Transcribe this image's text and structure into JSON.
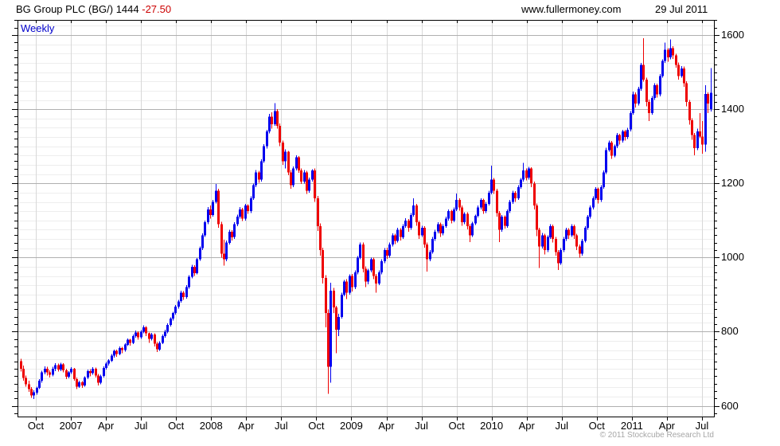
{
  "header": {
    "title": "BG Group PLC (BG/) 1444",
    "change": "-27.50",
    "website": "www.fullermoney.com",
    "date": "29 Jul 2011"
  },
  "chart": {
    "timeframe_label": "Weekly"
  },
  "footer": {
    "copyright": "© 2011 Stockcube Research Ltd"
  },
  "colors": {
    "up": "#0000ee",
    "down": "#ee0000",
    "grid_minor": "#ededed",
    "grid_vertical": "#d8d8d8",
    "grid_major": "#b0b0b0",
    "frame": "#000000"
  },
  "chart_data": {
    "type": "candlestick",
    "title": "BG Group PLC (BG/)",
    "timeframe": "Weekly",
    "last_price": 1444,
    "change": -27.5,
    "x_tick_labels": [
      "Oct",
      "2007",
      "Apr",
      "Jul",
      "Oct",
      "2008",
      "Apr",
      "Jul",
      "Oct",
      "2009",
      "Apr",
      "Jul",
      "Oct",
      "2010",
      "Apr",
      "Jul",
      "Oct",
      "2011",
      "Apr",
      "Jul"
    ],
    "y_tick_values": [
      600,
      800,
      1000,
      1200,
      1400,
      1600
    ],
    "ylim": [
      571,
      1641
    ],
    "y_major_step": 200,
    "y_minor_grid_step": 25,
    "y_minor_tick_step": 20,
    "grid": true,
    "legend": "none",
    "candles_ohlc": [
      [
        720,
        727,
        692,
        700
      ],
      [
        700,
        708,
        668,
        675
      ],
      [
        675,
        682,
        652,
        658
      ],
      [
        658,
        668,
        638,
        645
      ],
      [
        645,
        650,
        622,
        628
      ],
      [
        628,
        642,
        618,
        636
      ],
      [
        636,
        652,
        630,
        648
      ],
      [
        648,
        672,
        645,
        668
      ],
      [
        668,
        695,
        662,
        690
      ],
      [
        690,
        706,
        685,
        700
      ],
      [
        700,
        705,
        682,
        690
      ],
      [
        690,
        696,
        676,
        684
      ],
      [
        684,
        705,
        680,
        700
      ],
      [
        700,
        715,
        694,
        710
      ],
      [
        710,
        714,
        692,
        698
      ],
      [
        698,
        716,
        694,
        712
      ],
      [
        712,
        715,
        690,
        696
      ],
      [
        696,
        700,
        672,
        678
      ],
      [
        678,
        694,
        674,
        690
      ],
      [
        690,
        704,
        686,
        700
      ],
      [
        700,
        702,
        668,
        672
      ],
      [
        672,
        676,
        645,
        652
      ],
      [
        652,
        668,
        648,
        663
      ],
      [
        663,
        667,
        648,
        655
      ],
      [
        655,
        680,
        652,
        676
      ],
      [
        676,
        698,
        672,
        694
      ],
      [
        694,
        699,
        680,
        688
      ],
      [
        688,
        704,
        684,
        700
      ],
      [
        700,
        703,
        676,
        682
      ],
      [
        682,
        686,
        655,
        662
      ],
      [
        662,
        684,
        658,
        680
      ],
      [
        680,
        706,
        676,
        702
      ],
      [
        702,
        718,
        698,
        714
      ],
      [
        714,
        726,
        708,
        722
      ],
      [
        722,
        740,
        718,
        735
      ],
      [
        735,
        752,
        730,
        748
      ],
      [
        748,
        751,
        732,
        740
      ],
      [
        740,
        760,
        736,
        756
      ],
      [
        756,
        759,
        742,
        750
      ],
      [
        750,
        769,
        746,
        765
      ],
      [
        765,
        782,
        761,
        778
      ],
      [
        778,
        781,
        762,
        770
      ],
      [
        770,
        792,
        766,
        788
      ],
      [
        788,
        803,
        784,
        798
      ],
      [
        798,
        801,
        778,
        785
      ],
      [
        785,
        804,
        781,
        800
      ],
      [
        800,
        817,
        796,
        812
      ],
      [
        812,
        815,
        788,
        795
      ],
      [
        795,
        798,
        770,
        780
      ],
      [
        780,
        797,
        776,
        792
      ],
      [
        792,
        795,
        760,
        768
      ],
      [
        768,
        772,
        745,
        752
      ],
      [
        752,
        774,
        748,
        770
      ],
      [
        770,
        792,
        766,
        788
      ],
      [
        788,
        805,
        784,
        800
      ],
      [
        800,
        822,
        796,
        818
      ],
      [
        818,
        839,
        814,
        835
      ],
      [
        835,
        854,
        830,
        850
      ],
      [
        850,
        872,
        846,
        868
      ],
      [
        868,
        886,
        862,
        882
      ],
      [
        882,
        910,
        878,
        905
      ],
      [
        905,
        909,
        886,
        893
      ],
      [
        893,
        925,
        889,
        920
      ],
      [
        920,
        952,
        916,
        948
      ],
      [
        948,
        980,
        944,
        975
      ],
      [
        975,
        979,
        950,
        958
      ],
      [
        958,
        999,
        954,
        995
      ],
      [
        995,
        1030,
        991,
        1025
      ],
      [
        1025,
        1065,
        1020,
        1060
      ],
      [
        1060,
        1100,
        1055,
        1095
      ],
      [
        1095,
        1136,
        1090,
        1130
      ],
      [
        1130,
        1140,
        1105,
        1115
      ],
      [
        1115,
        1155,
        1110,
        1150
      ],
      [
        1150,
        1198,
        1146,
        1180
      ],
      [
        1180,
        1185,
        1080,
        1090
      ],
      [
        1090,
        1096,
        1000,
        1010
      ],
      [
        1010,
        1048,
        978,
        995
      ],
      [
        995,
        1046,
        990,
        1040
      ],
      [
        1040,
        1075,
        1035,
        1070
      ],
      [
        1070,
        1074,
        1046,
        1055
      ],
      [
        1055,
        1095,
        1050,
        1090
      ],
      [
        1090,
        1116,
        1085,
        1110
      ],
      [
        1110,
        1136,
        1105,
        1130
      ],
      [
        1130,
        1134,
        1098,
        1105
      ],
      [
        1105,
        1145,
        1100,
        1140
      ],
      [
        1140,
        1144,
        1118,
        1125
      ],
      [
        1125,
        1165,
        1120,
        1160
      ],
      [
        1160,
        1200,
        1155,
        1195
      ],
      [
        1195,
        1236,
        1190,
        1230
      ],
      [
        1230,
        1234,
        1202,
        1210
      ],
      [
        1210,
        1265,
        1205,
        1260
      ],
      [
        1260,
        1306,
        1255,
        1300
      ],
      [
        1300,
        1345,
        1294,
        1340
      ],
      [
        1340,
        1388,
        1335,
        1380
      ],
      [
        1380,
        1392,
        1348,
        1360
      ],
      [
        1360,
        1417,
        1355,
        1395
      ],
      [
        1395,
        1400,
        1348,
        1355
      ],
      [
        1355,
        1362,
        1300,
        1310
      ],
      [
        1310,
        1315,
        1250,
        1260
      ],
      [
        1260,
        1292,
        1240,
        1285
      ],
      [
        1285,
        1288,
        1222,
        1230
      ],
      [
        1230,
        1236,
        1186,
        1195
      ],
      [
        1195,
        1246,
        1190,
        1240
      ],
      [
        1240,
        1276,
        1235,
        1270
      ],
      [
        1270,
        1274,
        1228,
        1235
      ],
      [
        1235,
        1240,
        1198,
        1205
      ],
      [
        1205,
        1236,
        1200,
        1230
      ],
      [
        1230,
        1234,
        1172,
        1180
      ],
      [
        1180,
        1216,
        1175,
        1210
      ],
      [
        1210,
        1238,
        1205,
        1235
      ],
      [
        1235,
        1240,
        1150,
        1160
      ],
      [
        1160,
        1166,
        1072,
        1085
      ],
      [
        1085,
        1092,
        1005,
        1020
      ],
      [
        1020,
        1026,
        930,
        945
      ],
      [
        945,
        952,
        812,
        850
      ],
      [
        850,
        860,
        632,
        705
      ],
      [
        705,
        932,
        662,
        910
      ],
      [
        910,
        918,
        850,
        865
      ],
      [
        865,
        870,
        742,
        805
      ],
      [
        805,
        848,
        788,
        840
      ],
      [
        840,
        905,
        835,
        900
      ],
      [
        900,
        940,
        895,
        935
      ],
      [
        935,
        942,
        888,
        905
      ],
      [
        905,
        955,
        900,
        950
      ],
      [
        950,
        956,
        908,
        920
      ],
      [
        920,
        965,
        915,
        960
      ],
      [
        960,
        1004,
        955,
        1000
      ],
      [
        1000,
        1040,
        995,
        1035
      ],
      [
        1035,
        1040,
        960,
        970
      ],
      [
        970,
        976,
        920,
        935
      ],
      [
        935,
        970,
        928,
        965
      ],
      [
        965,
        1000,
        960,
        995
      ],
      [
        995,
        1000,
        942,
        950
      ],
      [
        950,
        956,
        905,
        930
      ],
      [
        930,
        965,
        925,
        960
      ],
      [
        960,
        995,
        955,
        990
      ],
      [
        990,
        1025,
        985,
        1020
      ],
      [
        1020,
        1026,
        996,
        1005
      ],
      [
        1005,
        1040,
        1000,
        1035
      ],
      [
        1035,
        1065,
        1030,
        1060
      ],
      [
        1060,
        1064,
        1036,
        1045
      ],
      [
        1045,
        1080,
        1040,
        1075
      ],
      [
        1075,
        1079,
        1046,
        1055
      ],
      [
        1055,
        1090,
        1050,
        1085
      ],
      [
        1085,
        1106,
        1080,
        1100
      ],
      [
        1100,
        1104,
        1070,
        1080
      ],
      [
        1080,
        1120,
        1075,
        1115
      ],
      [
        1115,
        1160,
        1110,
        1140
      ],
      [
        1140,
        1145,
        1086,
        1095
      ],
      [
        1095,
        1100,
        1050,
        1060
      ],
      [
        1060,
        1086,
        1055,
        1080
      ],
      [
        1080,
        1084,
        1026,
        1035
      ],
      [
        1035,
        1040,
        962,
        995
      ],
      [
        995,
        1020,
        990,
        1015
      ],
      [
        1015,
        1055,
        1010,
        1050
      ],
      [
        1050,
        1075,
        1045,
        1070
      ],
      [
        1070,
        1095,
        1065,
        1090
      ],
      [
        1090,
        1094,
        1056,
        1065
      ],
      [
        1065,
        1090,
        1060,
        1085
      ],
      [
        1085,
        1110,
        1080,
        1105
      ],
      [
        1105,
        1130,
        1100,
        1125
      ],
      [
        1125,
        1129,
        1092,
        1100
      ],
      [
        1100,
        1135,
        1095,
        1130
      ],
      [
        1130,
        1173,
        1125,
        1155
      ],
      [
        1155,
        1160,
        1126,
        1135
      ],
      [
        1135,
        1140,
        1086,
        1095
      ],
      [
        1095,
        1122,
        1090,
        1118
      ],
      [
        1118,
        1122,
        1076,
        1085
      ],
      [
        1085,
        1090,
        1042,
        1060
      ],
      [
        1060,
        1096,
        1055,
        1092
      ],
      [
        1092,
        1116,
        1088,
        1112
      ],
      [
        1112,
        1140,
        1108,
        1135
      ],
      [
        1135,
        1160,
        1130,
        1155
      ],
      [
        1155,
        1159,
        1118,
        1125
      ],
      [
        1125,
        1150,
        1120,
        1145
      ],
      [
        1145,
        1180,
        1140,
        1175
      ],
      [
        1175,
        1248,
        1170,
        1210
      ],
      [
        1210,
        1215,
        1172,
        1180
      ],
      [
        1180,
        1186,
        1110,
        1120
      ],
      [
        1120,
        1125,
        1042,
        1075
      ],
      [
        1075,
        1115,
        1070,
        1110
      ],
      [
        1110,
        1114,
        1078,
        1085
      ],
      [
        1085,
        1130,
        1080,
        1125
      ],
      [
        1125,
        1155,
        1120,
        1150
      ],
      [
        1150,
        1180,
        1145,
        1175
      ],
      [
        1175,
        1179,
        1150,
        1160
      ],
      [
        1160,
        1195,
        1155,
        1190
      ],
      [
        1190,
        1215,
        1185,
        1210
      ],
      [
        1210,
        1255,
        1205,
        1235
      ],
      [
        1235,
        1240,
        1208,
        1215
      ],
      [
        1215,
        1245,
        1210,
        1240
      ],
      [
        1240,
        1244,
        1190,
        1200
      ],
      [
        1200,
        1205,
        1130,
        1140
      ],
      [
        1140,
        1146,
        1058,
        1075
      ],
      [
        1075,
        1080,
        972,
        1030
      ],
      [
        1030,
        1066,
        1024,
        1060
      ],
      [
        1060,
        1064,
        1008,
        1020
      ],
      [
        1020,
        1060,
        1015,
        1055
      ],
      [
        1055,
        1090,
        1050,
        1085
      ],
      [
        1085,
        1089,
        1040,
        1050
      ],
      [
        1050,
        1055,
        1005,
        1015
      ],
      [
        1015,
        1020,
        966,
        985
      ],
      [
        985,
        1025,
        980,
        1020
      ],
      [
        1020,
        1055,
        1015,
        1050
      ],
      [
        1050,
        1080,
        1045,
        1075
      ],
      [
        1075,
        1079,
        1050,
        1060
      ],
      [
        1060,
        1090,
        1055,
        1085
      ],
      [
        1085,
        1089,
        1050,
        1060
      ],
      [
        1060,
        1064,
        1020,
        1030
      ],
      [
        1030,
        1035,
        1000,
        1010
      ],
      [
        1010,
        1050,
        1005,
        1045
      ],
      [
        1045,
        1085,
        1040,
        1080
      ],
      [
        1080,
        1115,
        1075,
        1110
      ],
      [
        1110,
        1140,
        1105,
        1135
      ],
      [
        1135,
        1165,
        1130,
        1160
      ],
      [
        1160,
        1190,
        1155,
        1185
      ],
      [
        1185,
        1189,
        1146,
        1155
      ],
      [
        1155,
        1195,
        1150,
        1190
      ],
      [
        1190,
        1235,
        1185,
        1230
      ],
      [
        1230,
        1296,
        1225,
        1290
      ],
      [
        1290,
        1316,
        1285,
        1310
      ],
      [
        1310,
        1314,
        1266,
        1275
      ],
      [
        1275,
        1305,
        1270,
        1300
      ],
      [
        1300,
        1336,
        1295,
        1330
      ],
      [
        1330,
        1334,
        1305,
        1315
      ],
      [
        1315,
        1345,
        1310,
        1340
      ],
      [
        1340,
        1344,
        1316,
        1325
      ],
      [
        1325,
        1350,
        1320,
        1345
      ],
      [
        1345,
        1395,
        1340,
        1390
      ],
      [
        1390,
        1448,
        1385,
        1440
      ],
      [
        1440,
        1445,
        1405,
        1415
      ],
      [
        1415,
        1460,
        1410,
        1455
      ],
      [
        1455,
        1525,
        1450,
        1520
      ],
      [
        1520,
        1592,
        1475,
        1480
      ],
      [
        1480,
        1485,
        1408,
        1420
      ],
      [
        1420,
        1426,
        1368,
        1390
      ],
      [
        1390,
        1436,
        1385,
        1430
      ],
      [
        1430,
        1470,
        1425,
        1465
      ],
      [
        1465,
        1469,
        1432,
        1440
      ],
      [
        1440,
        1495,
        1435,
        1490
      ],
      [
        1490,
        1535,
        1485,
        1530
      ],
      [
        1530,
        1580,
        1525,
        1560
      ],
      [
        1560,
        1565,
        1528,
        1540
      ],
      [
        1540,
        1588,
        1535,
        1565
      ],
      [
        1565,
        1570,
        1536,
        1545
      ],
      [
        1545,
        1550,
        1512,
        1520
      ],
      [
        1520,
        1526,
        1480,
        1490
      ],
      [
        1490,
        1516,
        1485,
        1510
      ],
      [
        1510,
        1515,
        1460,
        1470
      ],
      [
        1470,
        1476,
        1408,
        1420
      ],
      [
        1420,
        1425,
        1358,
        1370
      ],
      [
        1370,
        1376,
        1318,
        1330
      ],
      [
        1330,
        1336,
        1276,
        1295
      ],
      [
        1295,
        1348,
        1290,
        1340
      ],
      [
        1340,
        1390,
        1322,
        1326
      ],
      [
        1326,
        1368,
        1280,
        1305
      ],
      [
        1305,
        1465,
        1285,
        1441
      ],
      [
        1441,
        1446,
        1390,
        1415
      ],
      [
        1400,
        1511,
        1394,
        1444
      ]
    ]
  }
}
